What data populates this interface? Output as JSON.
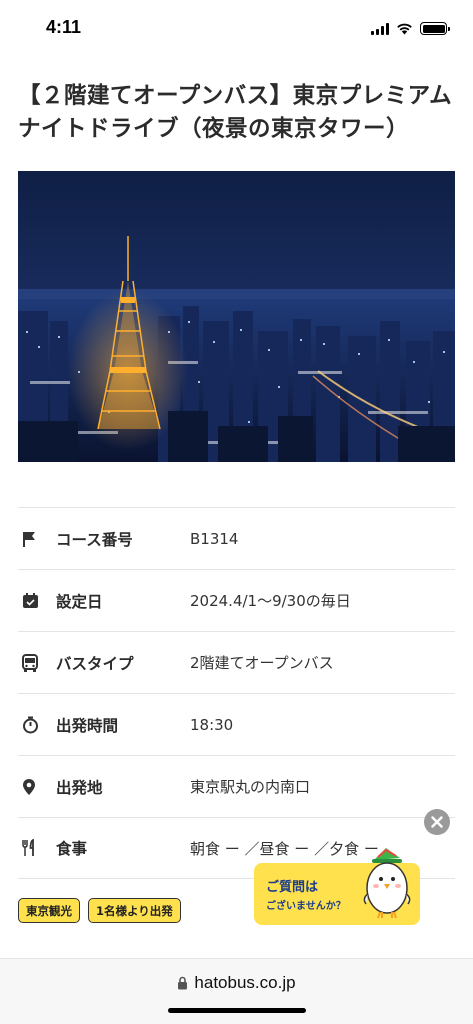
{
  "status_bar": {
    "time": "4:11"
  },
  "page": {
    "title": "【２階建てオープンバス】東京プレミアムナイトドライブ（夜景の東京タワー）"
  },
  "hero_image": {
    "description_icon": "tokyo-tower-night-photo"
  },
  "info_rows": [
    {
      "icon": "flag-icon",
      "label": "コース番号",
      "value": "B1314"
    },
    {
      "icon": "calendar-icon",
      "label": "設定日",
      "value": "2024.4/1〜9/30の毎日"
    },
    {
      "icon": "bus-icon",
      "label": "バスタイプ",
      "value": "2階建てオープンバス"
    },
    {
      "icon": "stopwatch-icon",
      "label": "出発時間",
      "value": "18:30"
    },
    {
      "icon": "map-pin-icon",
      "label": "出発地",
      "value": "東京駅丸の内南口"
    },
    {
      "icon": "cutlery-icon",
      "label": "食事",
      "value": "朝食 ー ／昼食 ー ／夕食 ー"
    }
  ],
  "tags": [
    "東京観光",
    "1名様より出発"
  ],
  "chat_widget": {
    "line1": "ご質問は",
    "line2": "ございませんか？"
  },
  "browser": {
    "url": "hatobus.co.jp"
  },
  "colors": {
    "accent_yellow": "#ffe14d",
    "chat_text": "#1d3d8a",
    "close_gray": "#9a9a9a"
  }
}
